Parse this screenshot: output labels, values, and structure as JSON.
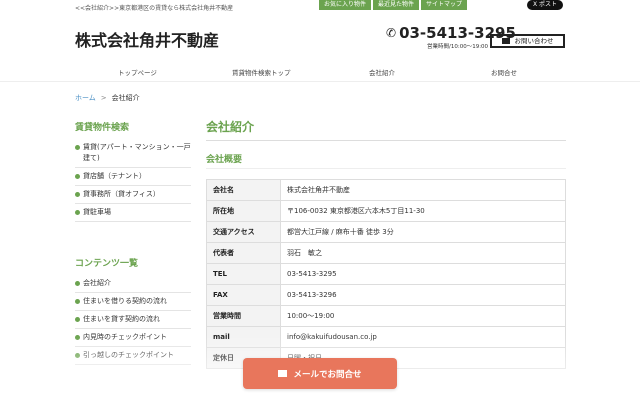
{
  "topbar": {
    "breadcrumb": "<<会社紹介>>東京都港区の賃貸なら株式会社角井不動産",
    "links": [
      "お気に入り物件",
      "最近見た物件",
      "サイトマップ"
    ],
    "xpost": "X ポスト"
  },
  "header": {
    "company": "株式会社角井不動産",
    "phone": "03-5413-3295",
    "hours": "営業時間/10:00〜19:00",
    "contact_button": "お問い合わせ"
  },
  "nav": [
    "トップページ",
    "賃貸物件検索トップ",
    "会社紹介",
    "お問合せ"
  ],
  "crumb": {
    "home": "ホーム",
    "sep": ">",
    "current": "会社紹介"
  },
  "sidebar": {
    "search_heading": "賃貸物件検索",
    "search_items": [
      "賃貸(アパート・マンション・一戸建て)",
      "貸店舗（テナント）",
      "貸事務所（貸オフィス）",
      "貸駐車場"
    ],
    "contents_heading": "コンテンツ一覧",
    "contents_items": [
      "会社紹介",
      "住まいを借りる契約の流れ",
      "住まいを貸す契約の流れ",
      "内見時のチェックポイント",
      "引っ越しのチェックポイント"
    ]
  },
  "main": {
    "heading": "会社紹介",
    "subheading": "会社概要",
    "rows": [
      {
        "label": "会社名",
        "value": "株式会社角井不動産"
      },
      {
        "label": "所在地",
        "value": "〒106-0032 東京都港区六本木5丁目11-30"
      },
      {
        "label": "交通アクセス",
        "value": "都営大江戸線 / 麻布十番 徒歩 3分"
      },
      {
        "label": "代表者",
        "value": "羽石　敏之"
      },
      {
        "label": "TEL",
        "value": "03-5413-3295"
      },
      {
        "label": "FAX",
        "value": "03-5413-3296"
      },
      {
        "label": "営業時間",
        "value": "10:00〜19:00"
      },
      {
        "label": "mail",
        "value": "info@kakuifudousan.co.jp"
      },
      {
        "label": "定休日",
        "value": "日曜・祝日"
      }
    ]
  },
  "float_button": "メールでお問合せ"
}
